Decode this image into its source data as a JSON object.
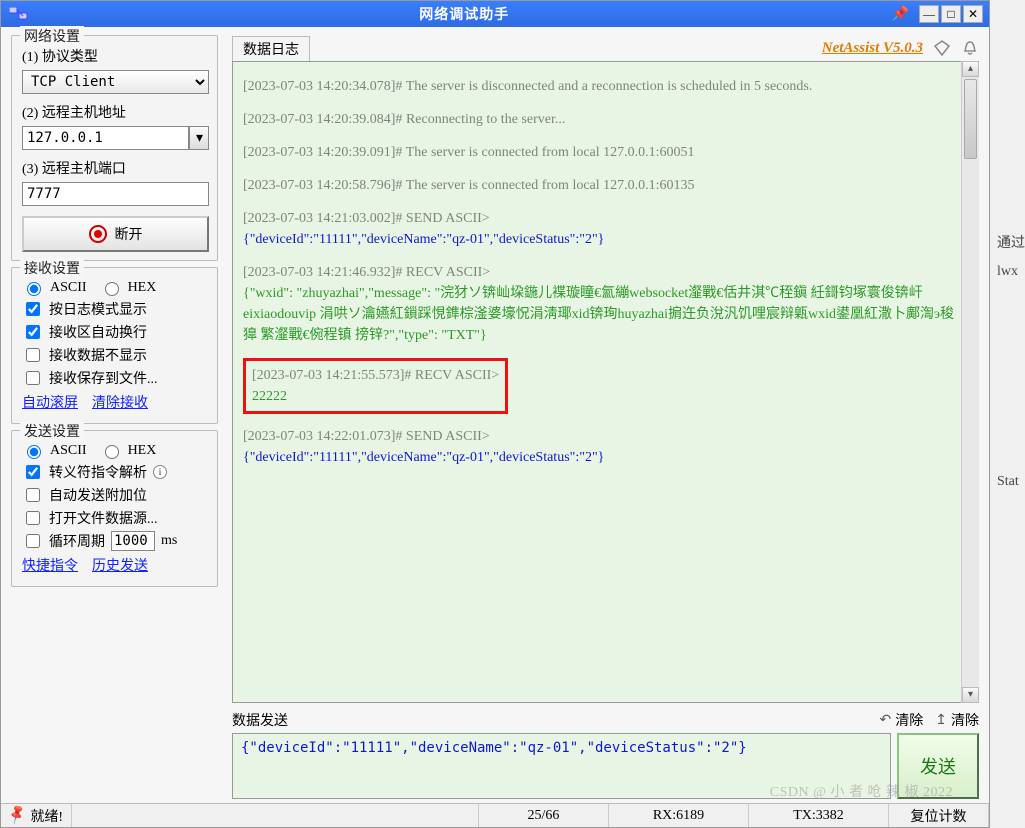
{
  "window": {
    "title": "网络调试助手"
  },
  "brand": {
    "name": "NetAssist V5.0.3"
  },
  "left": {
    "net_legend": "网络设置",
    "proto_label": "(1) 协议类型",
    "proto_value": "TCP Client",
    "host_label": "(2) 远程主机地址",
    "host_value": "127.0.0.1",
    "port_label": "(3) 远程主机端口",
    "port_value": "7777",
    "disconnect": "断开",
    "recv_legend": "接收设置",
    "ascii": "ASCII",
    "hex": "HEX",
    "recv_opts": [
      "按日志模式显示",
      "接收区自动换行",
      "接收数据不显示",
      "接收保存到文件..."
    ],
    "recv_checked": [
      true,
      true,
      false,
      false
    ],
    "auto_scroll": "自动滚屏",
    "clear_recv": "清除接收",
    "send_legend": "发送设置",
    "send_escape": "转义符指令解析",
    "send_auto_suffix": "自动发送附加位",
    "send_open_file": "打开文件数据源...",
    "send_loop": "循环周期",
    "send_loop_val": "1000",
    "send_loop_unit": "ms",
    "quick_cmd": "快捷指令",
    "history_send": "历史发送"
  },
  "log": {
    "header": "数据日志",
    "entries": [
      {
        "ts": "[2023-07-03 14:20:34.078]# ",
        "txt": "The server is disconnected and a reconnection is scheduled in 5 seconds.",
        "cls": "gray"
      },
      {
        "ts": "[2023-07-03 14:20:39.084]# ",
        "txt": "Reconnecting to the server...",
        "cls": "gray"
      },
      {
        "ts": "[2023-07-03 14:20:39.091]# ",
        "txt": "The server is connected from local 127.0.0.1:60051",
        "cls": "gray"
      },
      {
        "ts": "[2023-07-03 14:20:58.796]# ",
        "txt": "The server is connected from local 127.0.0.1:60135",
        "cls": "gray"
      },
      {
        "ts": "[2023-07-03 14:21:03.002]# SEND ASCII>",
        "body": "{\"deviceId\":\"11111\",\"deviceName\":\"qz-01\",\"deviceStatus\":\"2\"}",
        "bodycls": "blue"
      },
      {
        "ts": "[2023-07-03 14:21:46.932]# RECV ASCII>",
        "body": "{\"wxid\": \"zhuyazhai\",\"message\": \"浣犲ソ锛屾垜鍦儿褋璇瞳€氳繃websocket瀣戰€佸井淇℃秷鎭  紝鎶钧塚寰俊锛屽eixiaodouvip 涓哄ソ瀹嬿紅鎻踩悓鎨棕滏婆壕怳涓淸瑘xid锛珣huyazhai掮迕负涗汎饥哩宸辩甈wxid鍙凰紅潵卜鄺渹э稄獋  繁瀣戰€倇程镇  搒锌?\",\"type\": \"TXT\"}",
        "bodycls": "green"
      },
      {
        "ts": "[2023-07-03 14:21:55.573]# RECV ASCII>",
        "body": "22222",
        "bodycls": "green",
        "boxed": true
      },
      {
        "ts": "[2023-07-03 14:22:01.073]# SEND ASCII>",
        "body": "{\"deviceId\":\"11111\",\"deviceName\":\"qz-01\",\"deviceStatus\":\"2\"}",
        "bodycls": "blue"
      }
    ]
  },
  "send": {
    "header": "数据发送",
    "clear": "清除",
    "text": "{\"deviceId\":\"11111\",\"deviceName\":\"qz-01\",\"deviceStatus\":\"2\"}",
    "button": "发送"
  },
  "status": {
    "ready": "就绪!",
    "counter": "25/66",
    "rx": "RX:6189",
    "tx": "TX:3382",
    "reset": "复位计数"
  },
  "side_text": [
    "通过",
    "lwx",
    "",
    "Stat"
  ],
  "watermark": "CSDN @ 小 者 呛 辣 椒 2022"
}
